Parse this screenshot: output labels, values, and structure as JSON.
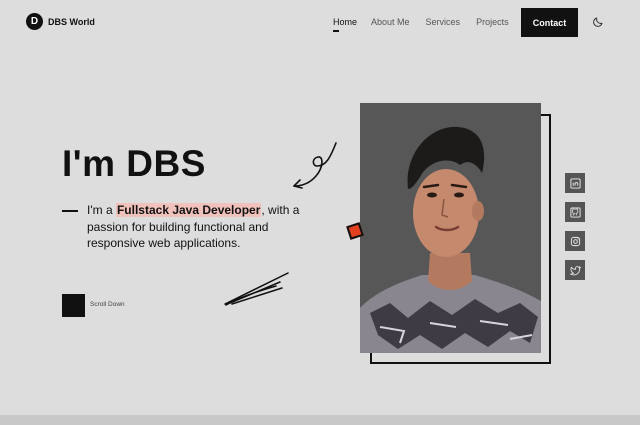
{
  "header": {
    "logo_letter": "D",
    "logo_text": "DBS World",
    "nav": [
      {
        "label": "Home",
        "active": true
      },
      {
        "label": "About Me",
        "active": false
      },
      {
        "label": "Services",
        "active": false
      },
      {
        "label": "Projects",
        "active": false
      }
    ],
    "contact_label": "Contact",
    "theme_icon": "moon-icon"
  },
  "hero": {
    "title": "I'm DBS",
    "desc_prefix": "I'm a ",
    "desc_highlight": "Fullstack Java Developer",
    "desc_suffix": ", with a passion for building functional and responsive web applications.",
    "scroll_label": "Scroll Down"
  },
  "social": [
    "linkedin-icon",
    "github-icon",
    "instagram-icon",
    "twitter-icon"
  ],
  "colors": {
    "background": "#dddddd",
    "dark": "#111111",
    "highlight": "#f1c1bb",
    "accent": "#e2401e",
    "photo_bg": "#575757"
  }
}
